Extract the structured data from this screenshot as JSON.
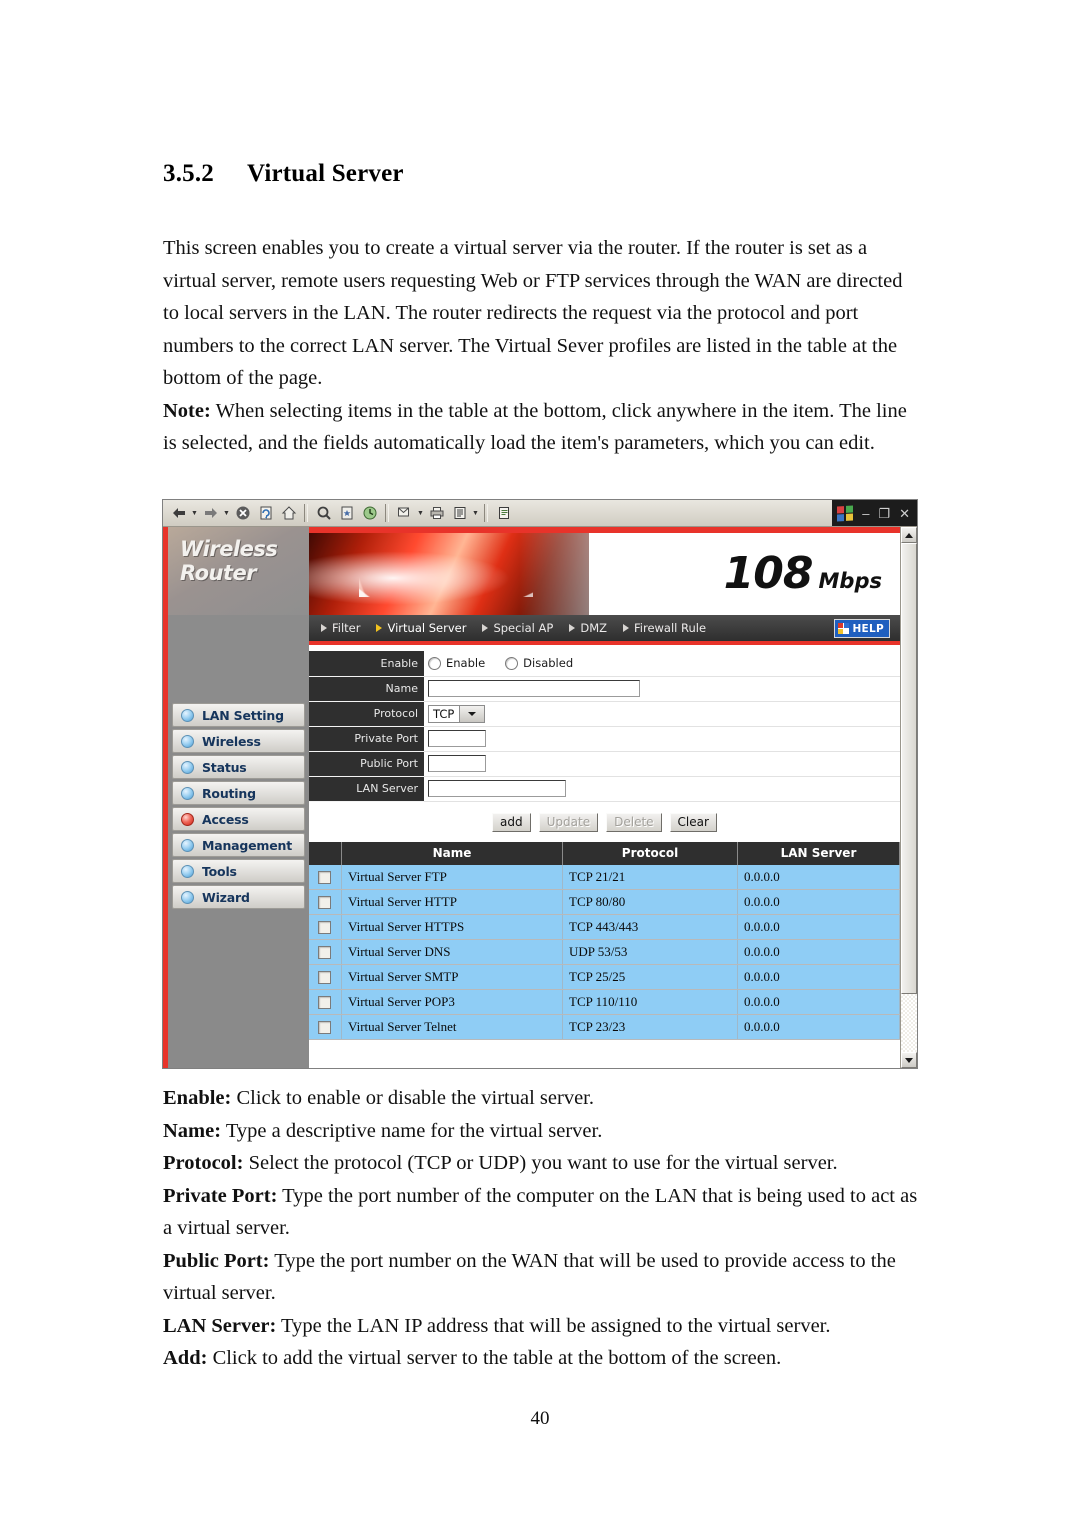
{
  "document": {
    "section_number": "3.5.2",
    "section_title": "Virtual Server",
    "page_number": "40",
    "intro_paragraph": "This screen enables you to create a virtual server via the router. If the router is set as a virtual server, remote users requesting Web or FTP services through the WAN are directed to local servers in the LAN. The router redirects the request via the protocol and port numbers to the correct LAN server.    The Virtual Sever profiles are listed in the table at the bottom of the page.",
    "note_label": "Note:",
    "note_text": " When selecting items in the table at the bottom, click anywhere in the item. The line is selected, and the fields automatically load the item's parameters, which you can edit.",
    "definitions": [
      {
        "term": "Enable:",
        "text": " Click to enable or disable the virtual server."
      },
      {
        "term": "Name:",
        "text": " Type a descriptive name for the virtual server."
      },
      {
        "term": "Protocol:",
        "text": " Select the protocol (TCP or UDP) you want to use for the virtual server."
      },
      {
        "term": "Private Port:",
        "text": " Type the port number of the computer on the LAN that is being used to act as a virtual server."
      },
      {
        "term": "Public Port:",
        "text": " Type the port number on the WAN that will be used to provide access to the virtual server."
      },
      {
        "term": "LAN Server:",
        "text": " Type the LAN IP address that will be assigned to the virtual server."
      },
      {
        "term": "Add:",
        "text": " Click to add the virtual server to the table at the bottom of the screen."
      }
    ]
  },
  "browser": {
    "toolbar_icons": [
      "back-icon",
      "back-dropdown-icon",
      "forward-icon",
      "forward-dropdown-icon",
      "stop-icon",
      "refresh-icon",
      "home-icon",
      "search-icon",
      "favorites-icon",
      "history-icon",
      "mail-icon",
      "mail-dropdown-icon",
      "print-icon",
      "edit-icon",
      "edit-dropdown-icon",
      "discuss-icon"
    ],
    "window_controls": {
      "logo": "windows-logo-icon",
      "minimize": "–",
      "restore": "❐",
      "close": "✕"
    },
    "scrollbar": {
      "up_arrow": "scroll-up-icon",
      "down_arrow": "scroll-down-icon"
    }
  },
  "router_ui": {
    "brand": {
      "line1": "Wireless",
      "line2": "Router",
      "speed_number": "108",
      "speed_unit": "Mbps"
    },
    "sidebar": [
      {
        "label": "LAN Setting",
        "active": false
      },
      {
        "label": "Wireless",
        "active": false
      },
      {
        "label": "Status",
        "active": false
      },
      {
        "label": "Routing",
        "active": false
      },
      {
        "label": "Access",
        "active": true
      },
      {
        "label": "Management",
        "active": false
      },
      {
        "label": "Tools",
        "active": false
      },
      {
        "label": "Wizard",
        "active": false
      }
    ],
    "nav": [
      {
        "label": "Filter",
        "active": false
      },
      {
        "label": "Virtual Server",
        "active": true
      },
      {
        "label": "Special AP",
        "active": false
      },
      {
        "label": "DMZ",
        "active": false
      },
      {
        "label": "Firewall Rule",
        "active": false
      }
    ],
    "help_button": "HELP",
    "form": {
      "enable": {
        "label": "Enable",
        "option_enable": "Enable",
        "option_disabled": "Disabled",
        "selected": ""
      },
      "name": {
        "label": "Name",
        "value": ""
      },
      "protocol": {
        "label": "Protocol",
        "value": "TCP",
        "options": [
          "TCP",
          "UDP"
        ]
      },
      "private_port": {
        "label": "Private Port",
        "value": ""
      },
      "public_port": {
        "label": "Public Port",
        "value": ""
      },
      "lan_server": {
        "label": "LAN Server",
        "value": ""
      }
    },
    "buttons": [
      {
        "label": "add",
        "disabled": false
      },
      {
        "label": "Update",
        "disabled": true
      },
      {
        "label": "Delete",
        "disabled": true
      },
      {
        "label": "Clear",
        "disabled": false
      }
    ],
    "table": {
      "headers": {
        "select": "",
        "name": "Name",
        "protocol": "Protocol",
        "lan_server": "LAN Server"
      },
      "rows": [
        {
          "name": "Virtual Server FTP",
          "protocol": "TCP 21/21",
          "lan_server": "0.0.0.0"
        },
        {
          "name": "Virtual Server HTTP",
          "protocol": "TCP 80/80",
          "lan_server": "0.0.0.0"
        },
        {
          "name": "Virtual Server HTTPS",
          "protocol": "TCP 443/443",
          "lan_server": "0.0.0.0"
        },
        {
          "name": "Virtual Server DNS",
          "protocol": "UDP 53/53",
          "lan_server": "0.0.0.0"
        },
        {
          "name": "Virtual Server SMTP",
          "protocol": "TCP 25/25",
          "lan_server": "0.0.0.0"
        },
        {
          "name": "Virtual Server POP3",
          "protocol": "TCP 110/110",
          "lan_server": "0.0.0.0"
        },
        {
          "name": "Virtual Server Telnet",
          "protocol": "TCP 23/23",
          "lan_server": "0.0.0.0"
        }
      ]
    }
  },
  "colors": {
    "accent_red": "#e8332a",
    "table_row_blue": "#8fcdf5",
    "header_dark": "#2f2f2f",
    "menu_text_blue": "#16355c"
  }
}
